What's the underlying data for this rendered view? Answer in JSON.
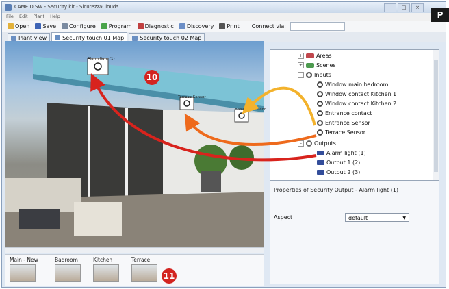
{
  "window": {
    "title": "CAME D SW - Security kit - SicurezzaCloud*",
    "controls": [
      "–",
      "□",
      "×"
    ]
  },
  "badge": "P",
  "menu": [
    "File",
    "Edit",
    "Plant",
    "Help"
  ],
  "toolbar": {
    "items": [
      {
        "label": "Open",
        "icon": "open-icon",
        "color": "#e2b13b"
      },
      {
        "label": "Save",
        "icon": "save-icon",
        "color": "#3f64b5"
      },
      {
        "label": "Configure",
        "icon": "configure-icon",
        "color": "#7a8aa0"
      },
      {
        "label": "Program",
        "icon": "program-icon",
        "color": "#4aa44a"
      },
      {
        "label": "Diagnostic",
        "icon": "diagnostic-icon",
        "color": "#c04040"
      },
      {
        "label": "Discovery",
        "icon": "discovery-icon",
        "color": "#6c8fc7"
      },
      {
        "label": "Print",
        "icon": "print-icon",
        "color": "#555555"
      }
    ],
    "connect_label": "Connect via:"
  },
  "tabs": [
    {
      "label": "Plant view",
      "active": false
    },
    {
      "label": "Security touch 01 Map",
      "active": true
    },
    {
      "label": "Security touch 02 Map",
      "active": false
    }
  ],
  "map": {
    "sensor_labels": [
      "Alarm light (1)",
      "Terrace Sensor",
      "Entrance Sensor"
    ]
  },
  "callouts": [
    "10",
    "11"
  ],
  "thumbnails": [
    {
      "label": "Main - New"
    },
    {
      "label": "Badroom"
    },
    {
      "label": "Kitchen"
    },
    {
      "label": "Terrace"
    }
  ],
  "tree": {
    "items": [
      {
        "label": "Areas",
        "kind": "folder-areas",
        "expander": "+"
      },
      {
        "label": "Scenes",
        "kind": "folder-scenes",
        "expander": "+"
      },
      {
        "label": "Inputs",
        "kind": "sensor",
        "expander": "–"
      },
      {
        "label": "Window main badroom",
        "kind": "sensor"
      },
      {
        "label": "Window contact Kitchen 1",
        "kind": "sensor"
      },
      {
        "label": "Window contact Kitchen 2",
        "kind": "sensor"
      },
      {
        "label": "Entrance contact",
        "kind": "sensor"
      },
      {
        "label": "Entrance Sensor",
        "kind": "sensor"
      },
      {
        "label": "Terrace Sensor",
        "kind": "sensor"
      },
      {
        "label": "Outputs",
        "kind": "folder-outputs",
        "expander": "–"
      },
      {
        "label": "Alarm light (1)",
        "kind": "output"
      },
      {
        "label": "Output 1 (2)",
        "kind": "output"
      },
      {
        "label": "Output 2 (3)",
        "kind": "output"
      }
    ]
  },
  "properties": {
    "title": "Properties of Security Output - Alarm light (1)",
    "aspect_label": "Aspect",
    "aspect_value": "default",
    "aspect_arrow": "▼"
  }
}
